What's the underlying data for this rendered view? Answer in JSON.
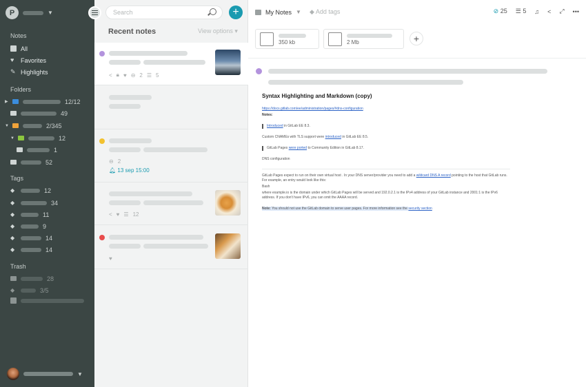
{
  "sidebar": {
    "notes_heading": "Notes",
    "all": "All",
    "favorites": "Favorites",
    "highlights": "Highlights",
    "folders_heading": "Folders",
    "folders": [
      {
        "count": "12/12",
        "color": "#3b8ddd"
      },
      {
        "count": "49",
        "color": "#cfd5d4"
      },
      {
        "count": "2/345",
        "color": "#f0a33a"
      },
      {
        "count": "12",
        "color": "#8cc63f"
      },
      {
        "count": "1",
        "color": "#cfd5d4"
      },
      {
        "count": "52",
        "color": "#cfd5d4"
      }
    ],
    "tags_heading": "Tags",
    "tags": [
      "12",
      "34",
      "11",
      "9",
      "14",
      "14"
    ],
    "trash_heading": "Trash",
    "trash": [
      "28",
      "3/5"
    ]
  },
  "list": {
    "search_placeholder": "Search",
    "title": "Recent notes",
    "view_options": "View options",
    "notes": [
      {
        "dot": "#b393dd",
        "meta_links": "2",
        "meta_checks": "5"
      },
      {},
      {
        "dot": "#f2c12e",
        "meta_links": "2",
        "reminder": "13 sep 15:00"
      },
      {
        "meta_checks": "12"
      },
      {
        "dot": "#e84c4c"
      }
    ]
  },
  "editor": {
    "notebook": "My Notes",
    "add_tags": "Add tags",
    "links_count": "25",
    "checklist_count": "5",
    "attachments": [
      {
        "size": "350 kb"
      },
      {
        "size": "2 Mb"
      }
    ],
    "doc": {
      "title": "Syntax Highlighting and Markdown (copy)",
      "url": "https://docs.gitlab.com/ee/administration/pages/#dns-configuration",
      "notes_label": "Notes:",
      "q1_link": "Introduced",
      "q1_rest": " in GitLab EE 8.3.",
      "p2_a": "Custom CNAMEs with TLS support were ",
      "p2_link": "introduced",
      "p2_b": " in GitLab EE 8.5.",
      "q2_a": "GitLab Pages ",
      "q2_link": "were ported",
      "q2_b": " to Community Edition in GitLab 8.17.",
      "dns": "DNS configuration",
      "p3_a": "GitLab Pages expect to run on their own virtual host . In your DNS server/provider you need to add a ",
      "p3_link": "wildcard DNS A record",
      "p3_b": " pointing to the host that GitLab runs. For example, an entry would look like this:",
      "bash": "Bash",
      "p4": "where example.io is the domain under which GitLab Pages will be served and 192.0.2.1 is the IPv4 address of your GitLab instance and 2001:1 is the IPv6 address. If you don't have IPv6, you can omit the AAAA record.",
      "note_label": "Note:",
      "note_text": " You should not use the GitLab domain to serve user pages. For more information see the ",
      "note_link": "security section"
    }
  }
}
